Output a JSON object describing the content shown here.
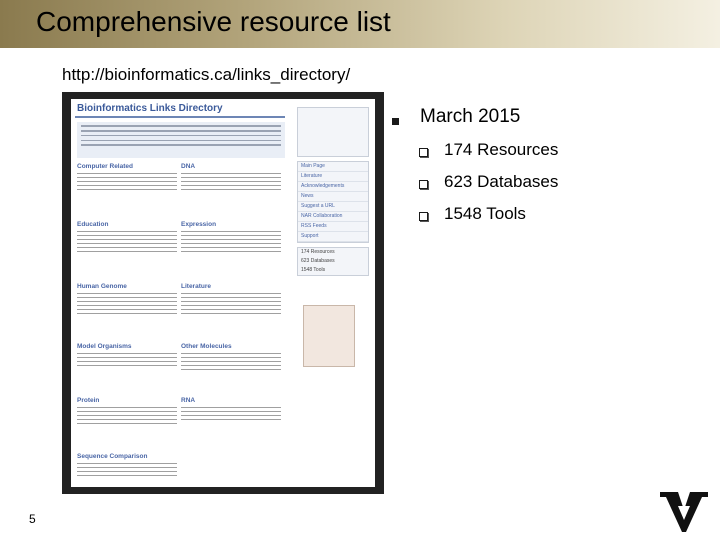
{
  "slide": {
    "title": "Comprehensive resource list",
    "url": "http://bioinformatics.ca/links_directory/",
    "page_number": "5"
  },
  "screenshot": {
    "site_title": "Bioinformatics Links Directory",
    "sections": [
      {
        "name": "Computer Related"
      },
      {
        "name": "DNA"
      },
      {
        "name": "Education"
      },
      {
        "name": "Expression"
      },
      {
        "name": "Human Genome"
      },
      {
        "name": "Literature"
      },
      {
        "name": "Model Organisms"
      },
      {
        "name": "Other Molecules"
      },
      {
        "name": "Protein"
      },
      {
        "name": "RNA"
      },
      {
        "name": "Sequence Comparison"
      }
    ],
    "sidebar_links": [
      "Main Page",
      "Literature",
      "Acknowledgements",
      "News",
      "Suggest a URL",
      "NAR Collaboration",
      "RSS Feeds",
      "Support"
    ],
    "badges": [
      "174 Resources",
      "623 Databases",
      "1548 Tools"
    ]
  },
  "bullets": {
    "main": "March 2015",
    "items": [
      "174 Resources",
      "623 Databases",
      "1548 Tools"
    ]
  },
  "colors": {
    "title_bar_start": "#8a7a4e",
    "title_bar_end": "#f4f0e2"
  },
  "icons": {
    "bullet": "square-bullet-icon",
    "logo": "vanderbilt-v-logo-icon"
  }
}
